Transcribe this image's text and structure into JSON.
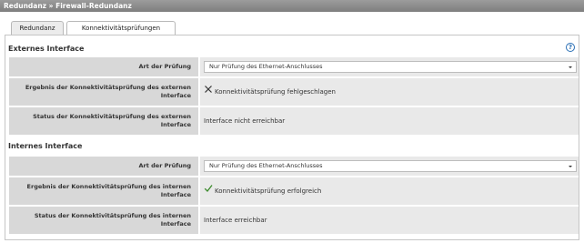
{
  "breadcrumb": "Redundanz » Firewall-Redundanz",
  "tabs": [
    {
      "label": "Redundanz",
      "active": false
    },
    {
      "label": "Konnektivitätsprüfungen",
      "active": true
    }
  ],
  "colors": {
    "success": "#3a8a2a",
    "fail": "#333333",
    "help": "#2a6fb5"
  },
  "external": {
    "title": "Externes Interface",
    "check_type_label": "Art der Prüfung",
    "check_type_value": "Nur Prüfung des Ethernet-Anschlusses",
    "result_label": "Ergebnis der Konnektivitätsprüfung des externen Interface",
    "result_icon": "close-icon",
    "result_value": "Konnektivitätsprüfung fehlgeschlagen",
    "status_label": "Status der Konnektivitätsprüfung des externen Interface",
    "status_value": "Interface nicht erreichbar"
  },
  "internal": {
    "title": "Internes Interface",
    "check_type_label": "Art der Prüfung",
    "check_type_value": "Nur Prüfung des Ethernet-Anschlusses",
    "result_label": "Ergebnis der Konnektivitätsprüfung des internen Interface",
    "result_icon": "check-icon",
    "result_value": "Konnektivitätsprüfung erfolgreich",
    "status_label": "Status der Konnektivitätsprüfung des internen Interface",
    "status_value": "Interface erreichbar"
  },
  "help_icon": "help-icon"
}
